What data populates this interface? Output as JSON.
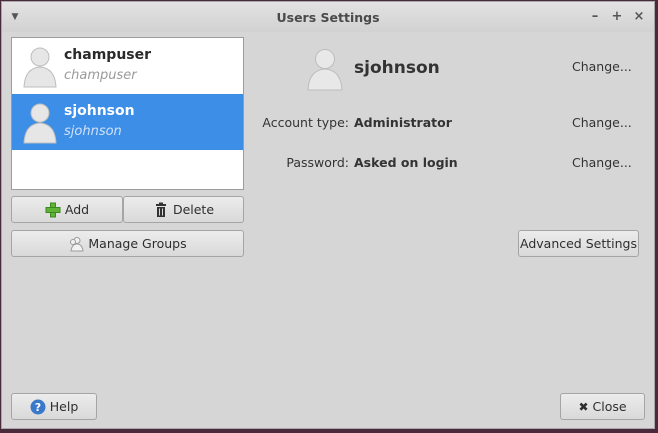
{
  "window": {
    "title": "Users Settings",
    "menu_icon": "chevron-down-icon",
    "minimize_label": "–",
    "maximize_label": "+",
    "close_label": "×"
  },
  "users": [
    {
      "username": "champuser",
      "fullname": "champuser",
      "selected": false
    },
    {
      "username": "sjohnson",
      "fullname": "sjohnson",
      "selected": true
    }
  ],
  "buttons": {
    "add": "Add",
    "delete": "Delete",
    "manage_groups": "Manage Groups",
    "advanced_settings": "Advanced Settings",
    "help": "Help",
    "close": "Close"
  },
  "details": {
    "username": "sjohnson",
    "change_label": "Change...",
    "account_type_label": "Account type:",
    "account_type_value": "Administrator",
    "password_label": "Password:",
    "password_value": "Asked on login"
  },
  "colors": {
    "selection": "#3d8ee6",
    "add_icon": "#5fb336",
    "help_icon": "#3a78c9"
  }
}
